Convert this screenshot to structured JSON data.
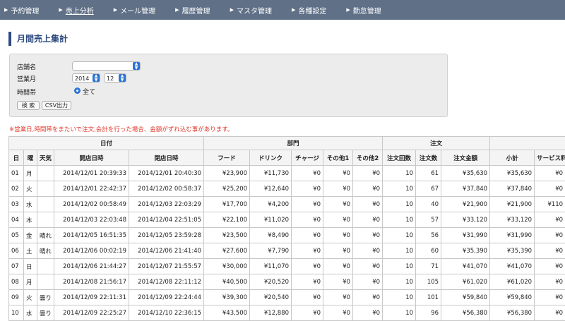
{
  "nav": {
    "items": [
      {
        "label": "予約管理"
      },
      {
        "label": "売上分析"
      },
      {
        "label": "メール管理"
      },
      {
        "label": "履歴管理"
      },
      {
        "label": "マスタ管理"
      },
      {
        "label": "各種設定"
      },
      {
        "label": "勤怠管理"
      }
    ],
    "active_index": 1,
    "arrow": "▶"
  },
  "page": {
    "title": "月間売上集計"
  },
  "search": {
    "store_label": "店舗名",
    "store_value": "",
    "month_label": "営業月",
    "year_value": "2014",
    "month_value": "12",
    "time_label": "時間帯",
    "time_option": "全て",
    "search_button": "検 索",
    "csv_button": "CSV出力"
  },
  "warning": "※営業日,時間帯をまたいで注文,会計を行った場合、金額がずれ込む事があります。",
  "table": {
    "groups": {
      "date": "日付",
      "dept": "部門",
      "order": "注文"
    },
    "headers": {
      "day": "日",
      "weekday": "曜",
      "weather": "天気",
      "open": "開店日時",
      "close": "閉店日時",
      "food": "フード",
      "drink": "ドリンク",
      "charge": "チャージ",
      "other1": "その他1",
      "other2": "その他2",
      "orders": "注文回数",
      "qty": "注文数",
      "amount": "注文金額",
      "subtotal": "小計",
      "service": "サービス料"
    },
    "rows": [
      {
        "day": "01",
        "weekday": "月",
        "weather": "",
        "open": "2014/12/01 20:39:33",
        "close": "2014/12/01 20:40:30",
        "food": "¥23,900",
        "drink": "¥11,730",
        "charge": "¥0",
        "other1": "¥0",
        "other2": "¥0",
        "orders": "10",
        "qty": "61",
        "amount": "¥35,630",
        "subtotal": "¥35,630",
        "service": "¥0"
      },
      {
        "day": "02",
        "weekday": "火",
        "weather": "",
        "open": "2014/12/01 22:42:37",
        "close": "2014/12/02 00:58:37",
        "food": "¥25,200",
        "drink": "¥12,640",
        "charge": "¥0",
        "other1": "¥0",
        "other2": "¥0",
        "orders": "10",
        "qty": "67",
        "amount": "¥37,840",
        "subtotal": "¥37,840",
        "service": "¥0"
      },
      {
        "day": "03",
        "weekday": "水",
        "weather": "",
        "open": "2014/12/02 00:58:49",
        "close": "2014/12/03 22:03:29",
        "food": "¥17,700",
        "drink": "¥4,200",
        "charge": "¥0",
        "other1": "¥0",
        "other2": "¥0",
        "orders": "10",
        "qty": "40",
        "amount": "¥21,900",
        "subtotal": "¥21,900",
        "service": "¥110"
      },
      {
        "day": "04",
        "weekday": "木",
        "weather": "",
        "open": "2014/12/03 22:03:48",
        "close": "2014/12/04 22:51:05",
        "food": "¥22,100",
        "drink": "¥11,020",
        "charge": "¥0",
        "other1": "¥0",
        "other2": "¥0",
        "orders": "10",
        "qty": "57",
        "amount": "¥33,120",
        "subtotal": "¥33,120",
        "service": "¥0"
      },
      {
        "day": "05",
        "weekday": "金",
        "weather": "晴れ",
        "open": "2014/12/05 16:51:35",
        "close": "2014/12/05 23:59:28",
        "food": "¥23,500",
        "drink": "¥8,490",
        "charge": "¥0",
        "other1": "¥0",
        "other2": "¥0",
        "orders": "10",
        "qty": "56",
        "amount": "¥31,990",
        "subtotal": "¥31,990",
        "service": "¥0"
      },
      {
        "day": "06",
        "weekday": "土",
        "weather": "晴れ",
        "open": "2014/12/06 00:02:19",
        "close": "2014/12/06 21:41:40",
        "food": "¥27,600",
        "drink": "¥7,790",
        "charge": "¥0",
        "other1": "¥0",
        "other2": "¥0",
        "orders": "10",
        "qty": "60",
        "amount": "¥35,390",
        "subtotal": "¥35,390",
        "service": "¥0"
      },
      {
        "day": "07",
        "weekday": "日",
        "weather": "",
        "open": "2014/12/06 21:44:27",
        "close": "2014/12/07 21:55:57",
        "food": "¥30,000",
        "drink": "¥11,070",
        "charge": "¥0",
        "other1": "¥0",
        "other2": "¥0",
        "orders": "10",
        "qty": "71",
        "amount": "¥41,070",
        "subtotal": "¥41,070",
        "service": "¥0"
      },
      {
        "day": "08",
        "weekday": "月",
        "weather": "",
        "open": "2014/12/08 21:56:17",
        "close": "2014/12/08 22:11:12",
        "food": "¥40,500",
        "drink": "¥20,520",
        "charge": "¥0",
        "other1": "¥0",
        "other2": "¥0",
        "orders": "10",
        "qty": "105",
        "amount": "¥61,020",
        "subtotal": "¥61,020",
        "service": "¥0"
      },
      {
        "day": "09",
        "weekday": "火",
        "weather": "曇り",
        "open": "2014/12/09 22:11:31",
        "close": "2014/12/09 22:24:44",
        "food": "¥39,300",
        "drink": "¥20,540",
        "charge": "¥0",
        "other1": "¥0",
        "other2": "¥0",
        "orders": "10",
        "qty": "101",
        "amount": "¥59,840",
        "subtotal": "¥59,840",
        "service": "¥0"
      },
      {
        "day": "10",
        "weekday": "水",
        "weather": "曇り",
        "open": "2014/12/09 22:25:27",
        "close": "2014/12/10 22:36:15",
        "food": "¥43,500",
        "drink": "¥12,880",
        "charge": "¥0",
        "other1": "¥0",
        "other2": "¥0",
        "orders": "10",
        "qty": "96",
        "amount": "¥56,380",
        "subtotal": "¥56,380",
        "service": "¥0"
      }
    ]
  }
}
